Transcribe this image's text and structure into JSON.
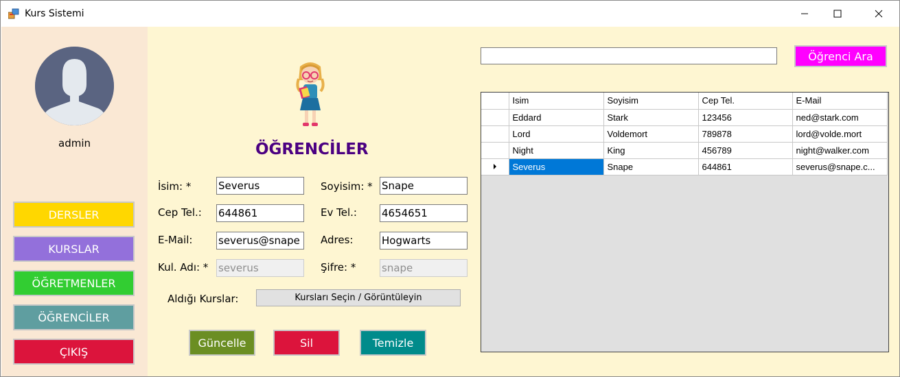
{
  "window": {
    "title": "Kurs Sistemi"
  },
  "sidebar": {
    "username": "admin",
    "nav": [
      {
        "label": "DERSLER",
        "color": "#ffd700"
      },
      {
        "label": "KURSLAR",
        "color": "#9370db"
      },
      {
        "label": "ÖĞRETMENLER",
        "color": "#32cd32"
      },
      {
        "label": "ÖĞRENCİLER",
        "color": "#5f9ea0"
      },
      {
        "label": "ÇIKIŞ",
        "color": "#dc143c"
      }
    ]
  },
  "form": {
    "title": "ÖĞRENCİLER",
    "labels": {
      "name": "İsim: *",
      "surname": "Soyisim: *",
      "mobile": "Cep Tel.:",
      "home_phone": "Ev Tel.:",
      "email": "E-Mail:",
      "address": "Adres:",
      "username": "Kul. Adı: *",
      "password": "Şifre: *",
      "courses": "Aldığı Kurslar:"
    },
    "values": {
      "name": "Severus",
      "surname": "Snape",
      "mobile": "644861",
      "home_phone": "4654651",
      "email": "severus@snape",
      "address": "Hogwarts",
      "username": "severus",
      "password": "snape"
    },
    "courses_button": "Kursları Seçin / Görüntüleyin",
    "actions": {
      "update": {
        "label": "Güncelle",
        "color": "#6b8e23"
      },
      "delete": {
        "label": "Sil",
        "color": "#dc143c"
      },
      "clear": {
        "label": "Temizle",
        "color": "#008b8b"
      }
    }
  },
  "search": {
    "value": "",
    "button_label": "Öğrenci Ara",
    "button_color": "#ff00ff"
  },
  "grid": {
    "columns": [
      "Isim",
      "Soyisim",
      "Cep Tel.",
      "E-Mail"
    ],
    "rows": [
      [
        "Eddard",
        "Stark",
        "123456",
        "ned@stark.com"
      ],
      [
        "Lord",
        "Voldemort",
        "789878",
        "lord@volde.mort"
      ],
      [
        "Night",
        "King",
        "456789",
        "night@walker.com"
      ],
      [
        "Severus",
        "Snape",
        "644861",
        "severus@snape.c..."
      ]
    ],
    "selected_row": 3
  }
}
